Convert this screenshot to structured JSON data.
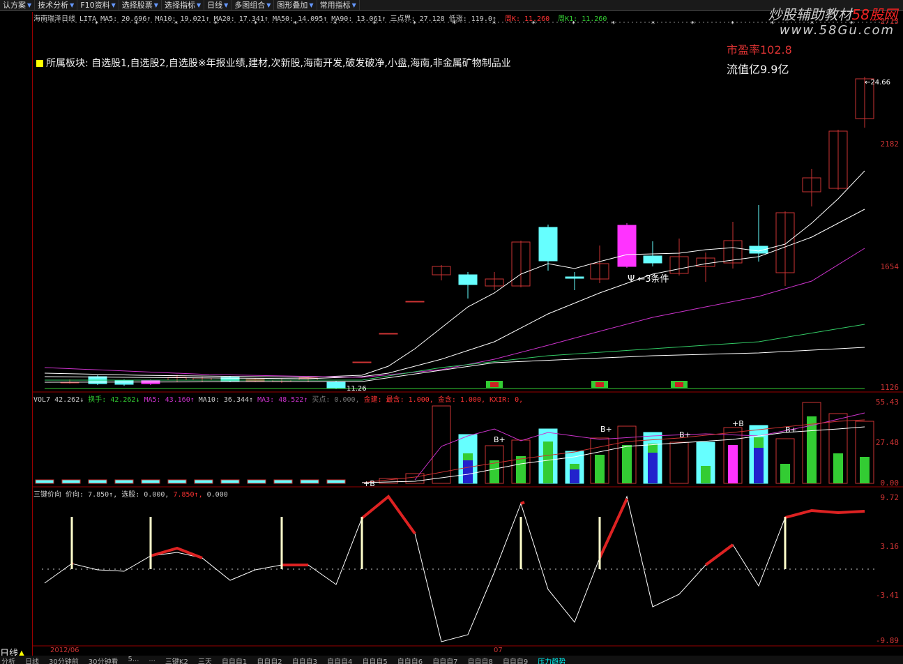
{
  "toolbar": {
    "items": [
      "认方案",
      "技术分析",
      "F10资料",
      "选择股票",
      "选择指标",
      "日线",
      "多图组合",
      "图形叠加",
      "常用指标"
    ]
  },
  "main": {
    "header": "海南瑞泽日线 LITA MA5: 20.696↑ MA10: 19.021↑ MA20: 17.341↑ MA50: 14.095↑ MA90: 13.061↑ 三点界: 27.128 低涨: 119.0↑",
    "header_tail1": "周K: 11.260",
    "header_tail2": "周K1: 11.260",
    "y_labels": [
      "2713",
      "2182",
      "1654",
      "1126"
    ],
    "sector_text": "所属板块: 自选股1,自选股2,自选股※年报业绩,建材,次新股,海南开发,破发破净,小盘,海南,非金属矿物制品业",
    "pe": "市盈率102.8",
    "mcap": "流值亿9.9亿",
    "price_tag": "24.66",
    "low_tag": "11.26",
    "annotation": "Ψ ←3条件",
    "watermark1": "炒股辅助教材",
    "watermark1_red": "58股网",
    "watermark2": "www.58Gu.com"
  },
  "vol": {
    "header_a": "VOL7 42.262↓",
    "header_b": "换手: 42.262↓",
    "header_c": "MA5: 43.160↑",
    "header_d": "MA10: 36.344↑",
    "header_e": "MA3: 48.522↑",
    "header_f": "买点: 0.000,",
    "header_g": "金建: 最含: 1.000,",
    "header_h": "金含: 1.000,",
    "header_i": "KXIR: 0,",
    "y_labels": [
      "55.43",
      "27.48",
      "0.00"
    ],
    "marks": [
      "B+",
      "B+",
      "B+",
      "+B",
      "B+",
      "+B"
    ]
  },
  "ind": {
    "header_a": "三键价向",
    "header_b": "价向: 7.850↑,",
    "header_c": "选股: 0.000,",
    "header_d": "7.850↑,",
    "header_e": "0.000",
    "y_labels": [
      "9.72",
      "3.16",
      "-3.41",
      "-9.89"
    ]
  },
  "dates": {
    "d1": "2012/06",
    "d2": "07"
  },
  "bottom": {
    "left_label": "日线",
    "tabs": [
      "分析",
      "日线",
      "30分钟前",
      "30分钟看",
      "5...",
      "...",
      "三键K2",
      "三天",
      "自自自1",
      "自自自2",
      "自自自3",
      "自自自4",
      "自自自5",
      "自自自6",
      "自自自7",
      "自自自8",
      "自自自9",
      "压力趋势"
    ]
  }
}
